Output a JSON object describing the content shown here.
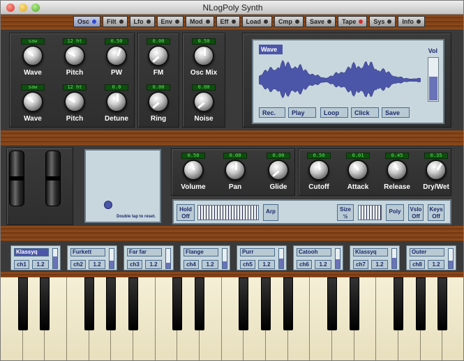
{
  "window": {
    "title": "NLogPoly Synth"
  },
  "toolbar": [
    {
      "label": "Osc",
      "active": true,
      "dot": "blue"
    },
    {
      "label": "Filt",
      "dot": "dark"
    },
    {
      "label": "Lfo",
      "dot": "dark"
    },
    {
      "label": "Env",
      "dot": "dark"
    },
    {
      "label": "Mod",
      "dot": "dark"
    },
    {
      "label": "Eff",
      "dot": "dark"
    },
    {
      "label": "Load",
      "dot": "dark"
    },
    {
      "label": "Cmp",
      "dot": "dark"
    },
    {
      "label": "Save",
      "dot": "dark"
    },
    {
      "label": "Tape",
      "dot": "red"
    },
    {
      "label": "Sys",
      "dot": "dark"
    },
    {
      "label": "Info",
      "dot": "dark"
    }
  ],
  "osc": {
    "row1": [
      {
        "label": "Wave",
        "lcd": "saw",
        "angle": -50
      },
      {
        "label": "Pitch",
        "lcd": "12 ht",
        "angle": -60
      },
      {
        "label": "PW",
        "lcd": "0.50",
        "angle": 20
      }
    ],
    "row2": [
      {
        "label": "Wave",
        "lcd": "saw",
        "angle": -50
      },
      {
        "label": "Pitch",
        "lcd": "12 ht",
        "angle": -60
      },
      {
        "label": "Detune",
        "lcd": "0.0",
        "angle": 0
      }
    ],
    "fm": {
      "label": "FM",
      "lcd": "0.00",
      "angle": -130
    },
    "ring": {
      "label": "Ring",
      "lcd": "0.00",
      "angle": -130
    },
    "oscmix": {
      "label": "Osc Mix",
      "lcd": "0.50",
      "angle": 0
    },
    "noise": {
      "label": "Noise",
      "lcd": "0.00",
      "angle": -130
    }
  },
  "wave_display": {
    "title": "Wave",
    "vol_label": "Vol",
    "vol_level": 0.55,
    "buttons": [
      "Rec.",
      "Play",
      "Loop",
      "Click",
      "Save"
    ]
  },
  "master": {
    "knobs": [
      {
        "label": "Volume",
        "lcd": "0.50",
        "angle": -20
      },
      {
        "label": "Pan",
        "lcd": "0.00",
        "angle": 0
      },
      {
        "label": "Glide",
        "lcd": "0.00",
        "angle": -130
      }
    ]
  },
  "filter": {
    "knobs": [
      {
        "label": "Cutoff",
        "lcd": "0.50",
        "angle": -10
      },
      {
        "label": "Attack",
        "lcd": "0.01",
        "angle": -40
      },
      {
        "label": "Release",
        "lcd": "0.45",
        "angle": -25
      },
      {
        "label": "Dry/Wet",
        "lcd": "0.35",
        "angle": 30
      }
    ]
  },
  "xypad": {
    "hint": "Double tap to reset."
  },
  "controls": {
    "hold": "Hold\nOff",
    "arp": "Arp",
    "size": "Size\n½",
    "poly": "Poly",
    "vslo": "Vslo\nOff",
    "keys": "Keys\nOff"
  },
  "channels": [
    {
      "name": "Klassyq",
      "ch": "ch1",
      "val": "1.2",
      "selected": true,
      "level": 0.6
    },
    {
      "name": "Furkett",
      "ch": "ch2",
      "val": "1.2",
      "level": 0.4
    },
    {
      "name": "Far far",
      "ch": "ch3",
      "val": "1.2",
      "level": 0.3
    },
    {
      "name": "Flange",
      "ch": "ch4",
      "val": "1.2",
      "level": 0.35
    },
    {
      "name": "Purr",
      "ch": "ch5",
      "val": "1.2",
      "level": 0.5
    },
    {
      "name": "Catooh",
      "ch": "ch6",
      "val": "1.2",
      "level": 0.45
    },
    {
      "name": "Klassyq",
      "ch": "ch7",
      "val": "1.2",
      "level": 0.55
    },
    {
      "name": "Outer",
      "ch": "ch8",
      "val": "1.2",
      "level": 0.4
    }
  ]
}
